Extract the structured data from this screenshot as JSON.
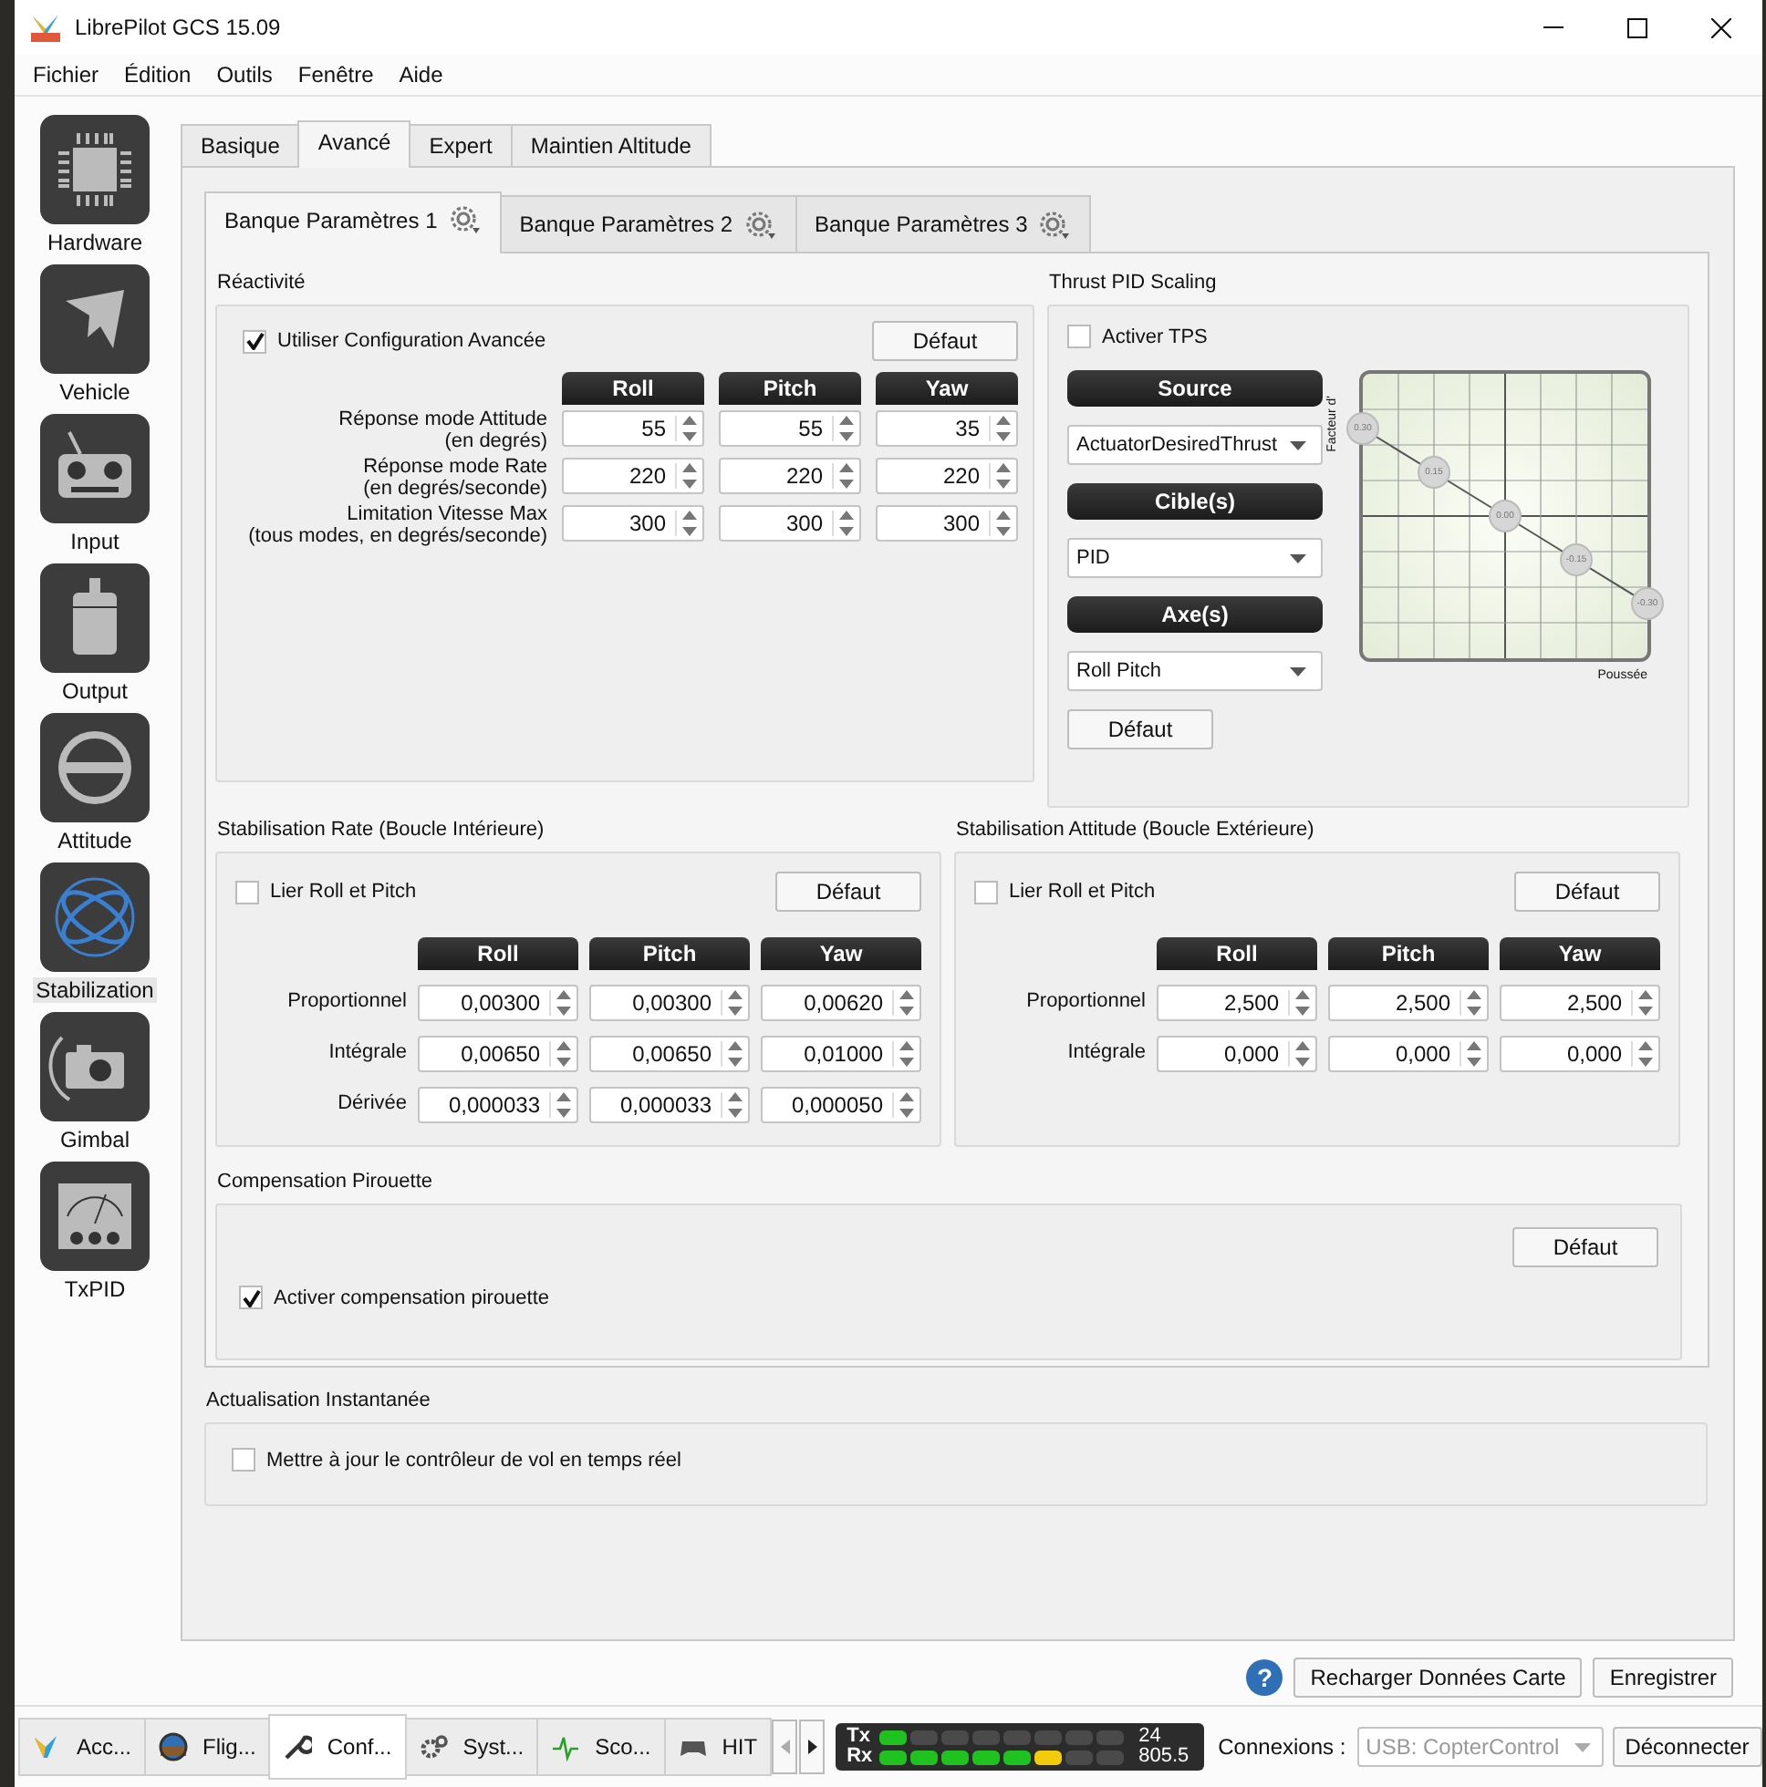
{
  "window": {
    "title": "LibrePilot GCS 15.09"
  },
  "menu": [
    "Fichier",
    "Édition",
    "Outils",
    "Fenêtre",
    "Aide"
  ],
  "sidebar": {
    "items": [
      {
        "label": "Hardware",
        "selected": false
      },
      {
        "label": "Vehicle",
        "selected": false
      },
      {
        "label": "Input",
        "selected": false
      },
      {
        "label": "Output",
        "selected": false
      },
      {
        "label": "Attitude",
        "selected": false
      },
      {
        "label": "Stabilization",
        "selected": true
      },
      {
        "label": "Gimbal",
        "selected": false
      },
      {
        "label": "TxPID",
        "selected": false
      }
    ]
  },
  "tabs": [
    {
      "label": "Basique",
      "selected": false
    },
    {
      "label": "Avancé",
      "selected": true
    },
    {
      "label": "Expert",
      "selected": false
    },
    {
      "label": "Maintien Altitude",
      "selected": false
    }
  ],
  "bank_tabs": [
    {
      "label": "Banque Paramètres 1",
      "selected": true
    },
    {
      "label": "Banque Paramètres 2",
      "selected": false
    },
    {
      "label": "Banque Paramètres 3",
      "selected": false
    }
  ],
  "reactivity": {
    "title": "Réactivité",
    "checkbox": {
      "label": "Utiliser Configuration Avancée",
      "checked": true
    },
    "default_button": "Défaut",
    "columns": [
      "Roll",
      "Pitch",
      "Yaw"
    ],
    "rows": [
      {
        "label": "Réponse mode Attitude\n(en degrés)",
        "values": [
          "55",
          "55",
          "35"
        ]
      },
      {
        "label": "Réponse mode Rate\n(en degrés/seconde)",
        "values": [
          "220",
          "220",
          "220"
        ]
      },
      {
        "label": "Limitation Vitesse Max\n(tous modes, en degrés/seconde)",
        "values": [
          "300",
          "300",
          "300"
        ]
      }
    ]
  },
  "thrust_pid_scaling": {
    "title": "Thrust PID Scaling",
    "checkbox": {
      "label": "Activer TPS",
      "checked": false
    },
    "source": {
      "header": "Source",
      "value": "ActuatorDesiredThrust"
    },
    "targets": {
      "header": "Cible(s)",
      "value": "PID"
    },
    "axes": {
      "header": "Axe(s)",
      "value": "Roll Pitch"
    },
    "default_button": "Défaut",
    "curve": {
      "y_label": "Facteur d'",
      "x_label": "Poussée",
      "points": [
        "0.30",
        "0.15",
        "0.00",
        "-0.15",
        "-0.30"
      ]
    }
  },
  "rate_stabilization": {
    "title": "Stabilisation Rate (Boucle Intérieure)",
    "checkbox": {
      "label": "Lier Roll et Pitch",
      "checked": false
    },
    "default_button": "Défaut",
    "columns": [
      "Roll",
      "Pitch",
      "Yaw"
    ],
    "rows": [
      {
        "label": "Proportionnel",
        "values": [
          "0,00300",
          "0,00300",
          "0,00620"
        ]
      },
      {
        "label": "Intégrale",
        "values": [
          "0,00650",
          "0,00650",
          "0,01000"
        ]
      },
      {
        "label": "Dérivée",
        "values": [
          "0,000033",
          "0,000033",
          "0,000050"
        ]
      }
    ]
  },
  "attitude_stabilization": {
    "title": "Stabilisation Attitude (Boucle Extérieure)",
    "checkbox": {
      "label": "Lier Roll et Pitch",
      "checked": false
    },
    "default_button": "Défaut",
    "columns": [
      "Roll",
      "Pitch",
      "Yaw"
    ],
    "rows": [
      {
        "label": "Proportionnel",
        "values": [
          "2,500",
          "2,500",
          "2,500"
        ]
      },
      {
        "label": "Intégrale",
        "values": [
          "0,000",
          "0,000",
          "0,000"
        ]
      }
    ]
  },
  "piro_compensation": {
    "title": "Compensation Pirouette",
    "default_button": "Défaut",
    "checkbox": {
      "label": "Activer compensation pirouette",
      "checked": true
    }
  },
  "realtime_update": {
    "title": "Actualisation Instantanée",
    "checkbox": {
      "label": "Mettre à jour le contrôleur de vol en temps réel",
      "checked": false
    }
  },
  "help_button": "?",
  "footer_buttons": [
    "Recharger Données Carte",
    "Enregistrer"
  ],
  "mode_tabs": [
    {
      "label": "Acc...",
      "selected": false
    },
    {
      "label": "Flig...",
      "selected": false
    },
    {
      "label": "Conf...",
      "selected": true
    },
    {
      "label": "Syst...",
      "selected": false
    },
    {
      "label": "Sco...",
      "selected": false
    },
    {
      "label": "HIT",
      "selected": false
    }
  ],
  "telemetry": {
    "tx": {
      "label": "Tx",
      "reading": "24",
      "segments": [
        {
          "color": "#1fc21f"
        },
        {
          "color": "#4a4a4a"
        },
        {
          "color": "#4a4a4a"
        },
        {
          "color": "#4a4a4a"
        },
        {
          "color": "#4a4a4a"
        },
        {
          "color": "#4a4a4a"
        },
        {
          "color": "#4a4a4a"
        },
        {
          "color": "#4a4a4a"
        }
      ]
    },
    "rx": {
      "label": "Rx",
      "reading": "805.5",
      "segments": [
        {
          "color": "#1fc21f"
        },
        {
          "color": "#1fc21f"
        },
        {
          "color": "#1fc21f"
        },
        {
          "color": "#1fc21f"
        },
        {
          "color": "#1fc21f"
        },
        {
          "color": "#f2cc0c"
        },
        {
          "color": "#4a4a4a"
        },
        {
          "color": "#4a4a4a"
        }
      ]
    }
  },
  "connection": {
    "label": "Connexions :",
    "device": "USB: CopterControl",
    "disabled": true,
    "button": "Déconnecter"
  }
}
